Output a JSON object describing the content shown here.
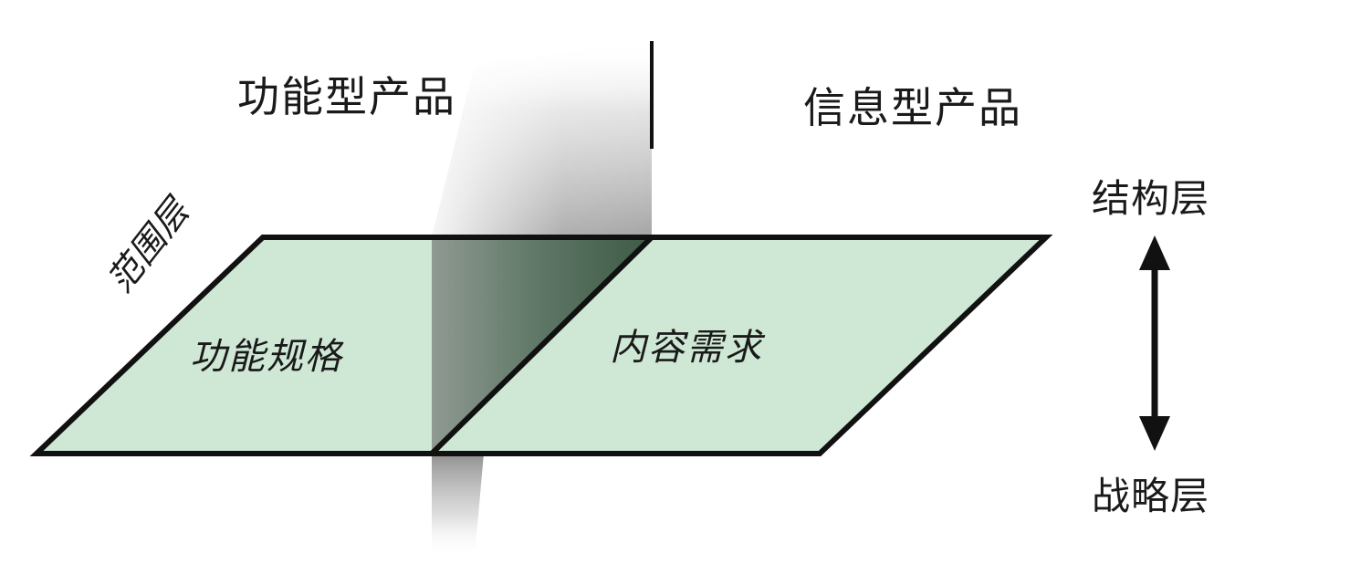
{
  "diagram": {
    "headings": {
      "functional_product": "功能型产品",
      "information_product": "信息型产品"
    },
    "plane": {
      "layer_name": "范围层",
      "left_area": "功能规格",
      "right_area": "内容需求"
    },
    "axis": {
      "top": "结构层",
      "bottom": "战略层"
    },
    "colors": {
      "plane_fill": "#cfe8d5",
      "plane_border": "#111111",
      "divider_gradient_dark": "#3f5a47"
    }
  }
}
